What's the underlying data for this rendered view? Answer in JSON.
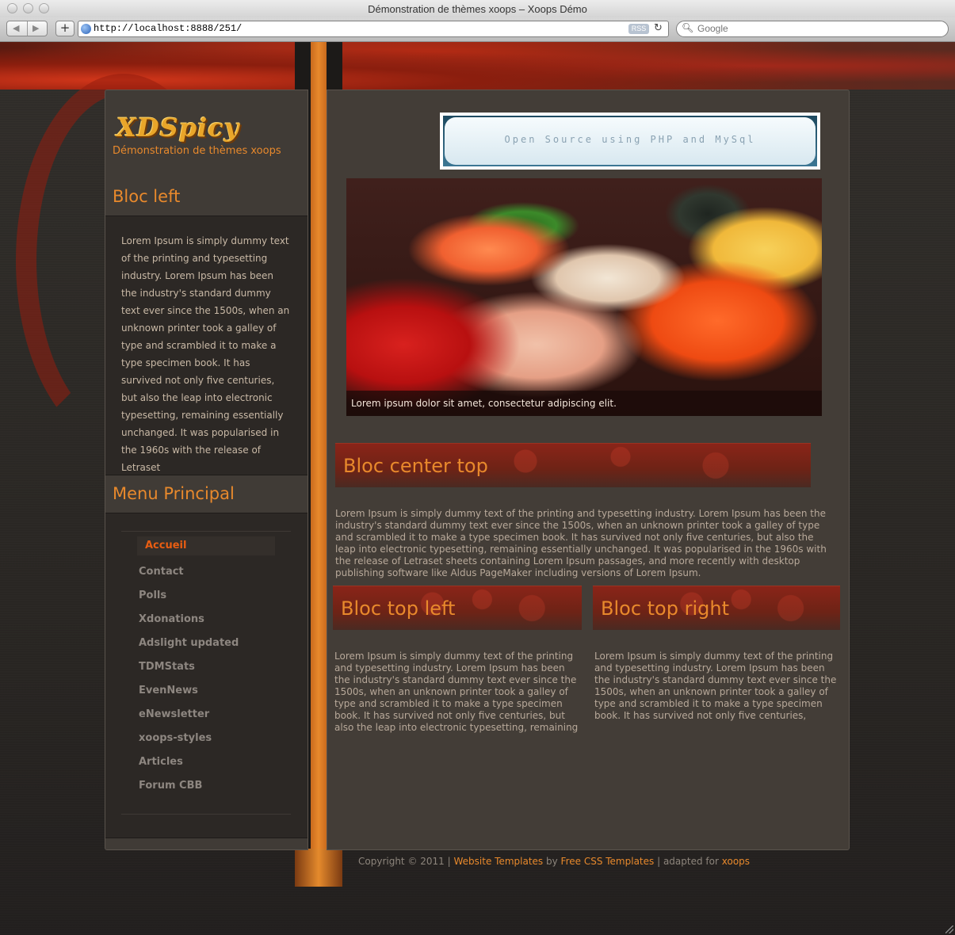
{
  "window": {
    "title": "Démonstration de thèmes xoops – Xoops Démo"
  },
  "toolbar": {
    "url": "http://localhost:8888/251/",
    "rss_label": "RSS",
    "search_placeholder": "Google"
  },
  "site": {
    "logo": "XDSpicy",
    "tagline": "Démonstration de thèmes xoops"
  },
  "left_block": {
    "title": "Bloc left",
    "text": "Lorem Ipsum is simply dummy text of the printing and typesetting industry. Lorem Ipsum has been the industry's standard dummy text ever since the 1500s, when an unknown printer took a galley of type and scrambled it to make a type specimen book. It has survived not only five centuries, but also the leap into electronic typesetting, remaining essentially unchanged. It was popularised in the 1960s with the release of Letraset"
  },
  "menu": {
    "title": "Menu Principal",
    "items": [
      {
        "label": "Accueil",
        "active": true
      },
      {
        "label": "Contact"
      },
      {
        "label": "Polls"
      },
      {
        "label": "Xdonations"
      },
      {
        "label": "Adslight updated"
      },
      {
        "label": "TDMStats"
      },
      {
        "label": "EvenNews"
      },
      {
        "label": "eNewsletter"
      },
      {
        "label": "xoops-styles"
      },
      {
        "label": "Articles"
      },
      {
        "label": "Forum CBB"
      }
    ]
  },
  "banner": {
    "text": "Open Source using PHP and MySql"
  },
  "hero": {
    "caption": "Lorem ipsum dolor sit amet, consectetur adipiscing elit."
  },
  "center_top": {
    "title": "Bloc center top",
    "text": "Lorem Ipsum is simply dummy text of the printing and typesetting industry. Lorem Ipsum has been the industry's standard dummy text ever since the 1500s, when an unknown printer took a galley of type and scrambled it to make a type specimen book. It has survived not only five centuries, but also the leap into electronic typesetting, remaining essentially unchanged. It was popularised in the 1960s with the release of Letraset sheets containing Lorem Ipsum passages, and more recently with desktop publishing software like Aldus PageMaker including versions of Lorem Ipsum."
  },
  "top_left": {
    "title": "Bloc top left",
    "text": "Lorem Ipsum is simply dummy text of the printing and typesetting industry. Lorem Ipsum has been the industry's standard dummy text ever since the 1500s, when an unknown printer took a galley of type and scrambled it to make a type specimen book. It has survived not only five centuries, but also the leap into electronic typesetting, remaining"
  },
  "top_right": {
    "title": "Bloc top right",
    "text": "Lorem Ipsum is simply dummy text of the printing and typesetting industry. Lorem Ipsum has been the industry's standard dummy text ever since the 1500s, when an unknown printer took a galley of type and scrambled it to make a type specimen book. It has survived not only five centuries,"
  },
  "footer": {
    "copyright": "Copyright © 2011 |",
    "link1": "Website Templates",
    "by": "by",
    "link2": "Free CSS Templates",
    "adapted": "| adapted for",
    "link3": "xoops"
  },
  "colors": {
    "accent": "#e8892c",
    "active_menu": "#e85d12",
    "panel": "#403b36"
  }
}
